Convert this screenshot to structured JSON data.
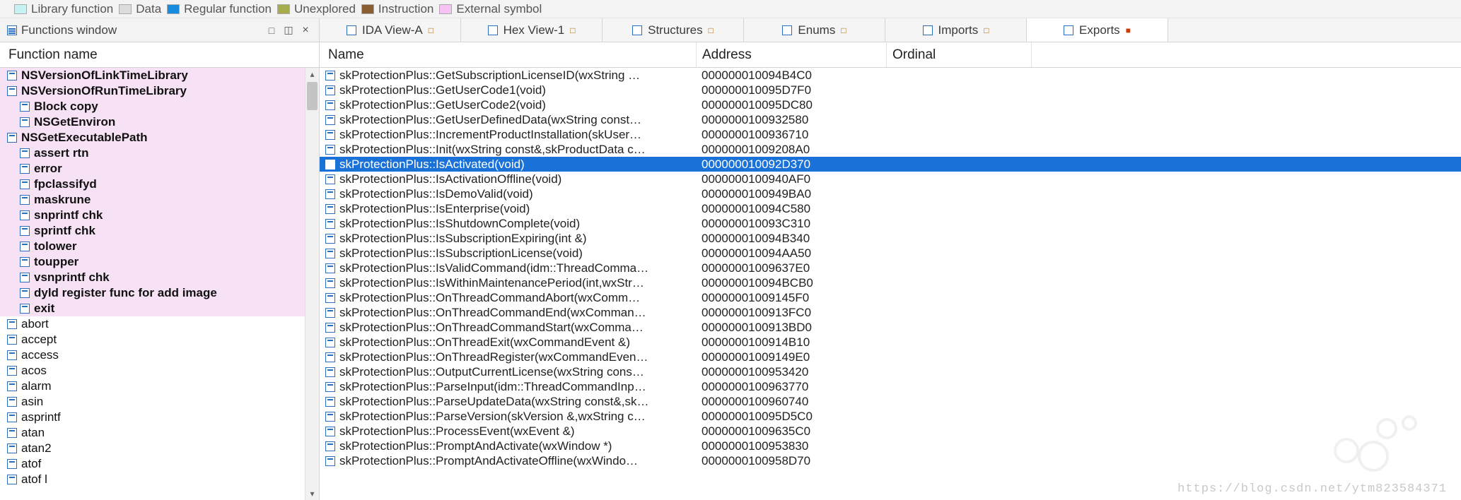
{
  "legend": [
    {
      "label": "Library function",
      "swatch": "sw-libfn"
    },
    {
      "label": "Data",
      "swatch": "sw-data"
    },
    {
      "label": "Regular function",
      "swatch": "sw-regfn"
    },
    {
      "label": "Unexplored",
      "swatch": "sw-unex"
    },
    {
      "label": "Instruction",
      "swatch": "sw-instr"
    },
    {
      "label": "External symbol",
      "swatch": "sw-extsym"
    }
  ],
  "left_panel": {
    "title": "Functions window",
    "column_header": "Function name",
    "items": [
      {
        "label": "NSVersionOfLinkTimeLibrary",
        "cls": "pink"
      },
      {
        "label": "NSVersionOfRunTimeLibrary",
        "cls": "pink"
      },
      {
        "label": "Block copy",
        "cls": "pinksub"
      },
      {
        "label": "NSGetEnviron",
        "cls": "pinksub"
      },
      {
        "label": "NSGetExecutablePath",
        "cls": "pink"
      },
      {
        "label": "assert rtn",
        "cls": "pinksub"
      },
      {
        "label": "error",
        "cls": "pinksub"
      },
      {
        "label": "fpclassifyd",
        "cls": "pinksub"
      },
      {
        "label": "maskrune",
        "cls": "pinksub"
      },
      {
        "label": "snprintf chk",
        "cls": "pinksub"
      },
      {
        "label": "sprintf chk",
        "cls": "pinksub"
      },
      {
        "label": "tolower",
        "cls": "pinksub"
      },
      {
        "label": "toupper",
        "cls": "pinksub"
      },
      {
        "label": "vsnprintf chk",
        "cls": "pinksub"
      },
      {
        "label": "dyld register func for add image",
        "cls": "pinksub"
      },
      {
        "label": "exit",
        "cls": "pinksub"
      },
      {
        "label": "abort",
        "cls": "nobold"
      },
      {
        "label": "accept",
        "cls": "nobold"
      },
      {
        "label": "access",
        "cls": "nobold"
      },
      {
        "label": "acos",
        "cls": "nobold"
      },
      {
        "label": "alarm",
        "cls": "nobold"
      },
      {
        "label": "asin",
        "cls": "nobold"
      },
      {
        "label": "asprintf",
        "cls": "nobold"
      },
      {
        "label": "atan",
        "cls": "nobold"
      },
      {
        "label": "atan2",
        "cls": "nobold"
      },
      {
        "label": "atof",
        "cls": "nobold"
      },
      {
        "label": "atof l",
        "cls": "nobold"
      }
    ]
  },
  "tabs": [
    {
      "label": "IDA View-A",
      "icon": true,
      "close": "□"
    },
    {
      "label": "Hex View-1",
      "icon": true,
      "close": "□"
    },
    {
      "label": "Structures",
      "icon": true,
      "close": "□"
    },
    {
      "label": "Enums",
      "icon": true,
      "close": "□"
    },
    {
      "label": "Imports",
      "icon": true,
      "close": "□"
    },
    {
      "label": "Exports",
      "icon": true,
      "close": "■",
      "active": true,
      "cls": "exports"
    }
  ],
  "exports": {
    "columns": {
      "name": "Name",
      "address": "Address",
      "ordinal": "Ordinal"
    },
    "rows": [
      {
        "name": "skProtectionPlus::GetSubscriptionLicenseID(wxString …",
        "addr": "000000010094B4C0"
      },
      {
        "name": "skProtectionPlus::GetUserCode1(void)",
        "addr": "000000010095D7F0"
      },
      {
        "name": "skProtectionPlus::GetUserCode2(void)",
        "addr": "000000010095DC80"
      },
      {
        "name": "skProtectionPlus::GetUserDefinedData(wxString const…",
        "addr": "0000000100932580"
      },
      {
        "name": "skProtectionPlus::IncrementProductInstallation(skUser…",
        "addr": "0000000100936710"
      },
      {
        "name": "skProtectionPlus::Init(wxString const&,skProductData c…",
        "addr": "00000001009208A0"
      },
      {
        "name": "skProtectionPlus::IsActivated(void)",
        "addr": "000000010092D370",
        "selected": true
      },
      {
        "name": "skProtectionPlus::IsActivationOffline(void)",
        "addr": "0000000100940AF0"
      },
      {
        "name": "skProtectionPlus::IsDemoValid(void)",
        "addr": "0000000100949BA0"
      },
      {
        "name": "skProtectionPlus::IsEnterprise(void)",
        "addr": "000000010094C580"
      },
      {
        "name": "skProtectionPlus::IsShutdownComplete(void)",
        "addr": "000000010093C310"
      },
      {
        "name": "skProtectionPlus::IsSubscriptionExpiring(int &)",
        "addr": "000000010094B340"
      },
      {
        "name": "skProtectionPlus::IsSubscriptionLicense(void)",
        "addr": "000000010094AA50"
      },
      {
        "name": "skProtectionPlus::IsValidCommand(idm::ThreadComma…",
        "addr": "00000001009637E0"
      },
      {
        "name": "skProtectionPlus::IsWithinMaintenancePeriod(int,wxStr…",
        "addr": "000000010094BCB0"
      },
      {
        "name": "skProtectionPlus::OnThreadCommandAbort(wxComm…",
        "addr": "00000001009145F0"
      },
      {
        "name": "skProtectionPlus::OnThreadCommandEnd(wxComman…",
        "addr": "0000000100913FC0"
      },
      {
        "name": "skProtectionPlus::OnThreadCommandStart(wxComma…",
        "addr": "0000000100913BD0"
      },
      {
        "name": "skProtectionPlus::OnThreadExit(wxCommandEvent &)",
        "addr": "0000000100914B10"
      },
      {
        "name": "skProtectionPlus::OnThreadRegister(wxCommandEven…",
        "addr": "00000001009149E0"
      },
      {
        "name": "skProtectionPlus::OutputCurrentLicense(wxString cons…",
        "addr": "0000000100953420"
      },
      {
        "name": "skProtectionPlus::ParseInput(idm::ThreadCommandInp…",
        "addr": "0000000100963770"
      },
      {
        "name": "skProtectionPlus::ParseUpdateData(wxString const&,sk…",
        "addr": "0000000100960740"
      },
      {
        "name": "skProtectionPlus::ParseVersion(skVersion &,wxString c…",
        "addr": "000000010095D5C0"
      },
      {
        "name": "skProtectionPlus::ProcessEvent(wxEvent &)",
        "addr": "00000001009635C0"
      },
      {
        "name": "skProtectionPlus::PromptAndActivate(wxWindow *)",
        "addr": "0000000100953830"
      },
      {
        "name": "skProtectionPlus::PromptAndActivateOffline(wxWindo…",
        "addr": "0000000100958D70"
      }
    ]
  },
  "watermark": "https://blog.csdn.net/ytm823584371"
}
